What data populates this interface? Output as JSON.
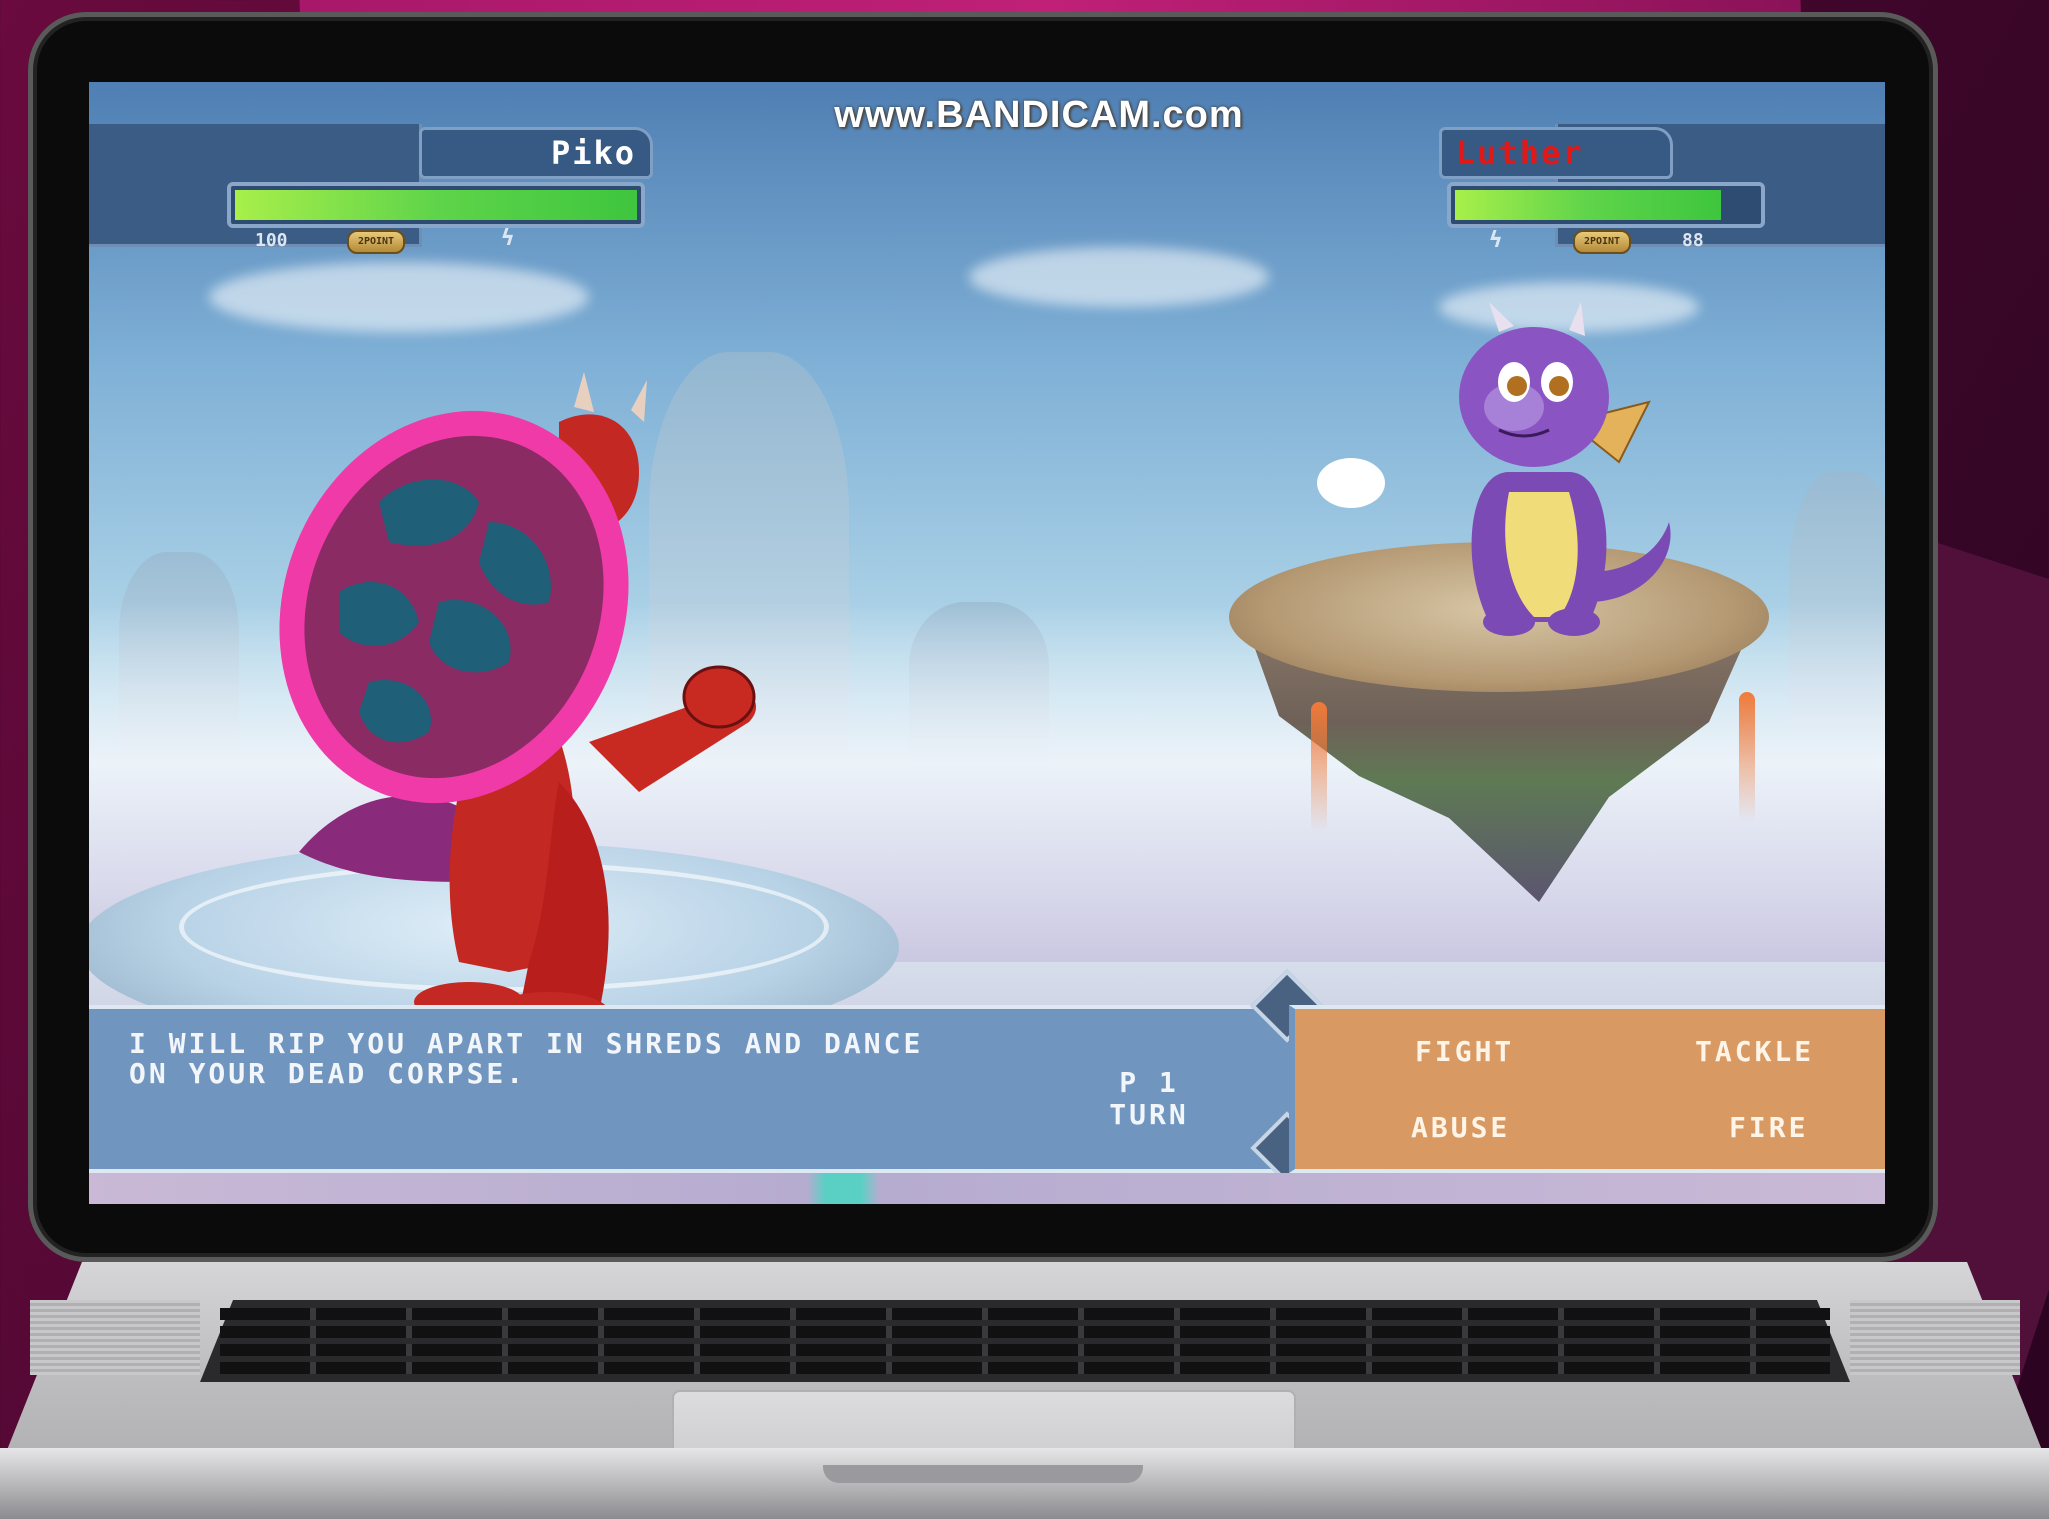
{
  "watermark": "www.BANDICAM.com",
  "player1": {
    "name": "Piko",
    "name_color": "#ffffff",
    "hp_value": "100",
    "hp_fraction": 1.0,
    "badge": "2POINT",
    "icon": "lightning-icon"
  },
  "player2": {
    "name": "Luther",
    "name_color": "#e01818",
    "hp_value": "88",
    "hp_fraction": 0.88,
    "badge": "2POINT",
    "icon": "lightning-icon"
  },
  "dialog": {
    "text_line1": "I WILL RIP YOU APART IN SHREDS AND DANCE",
    "text_line2": "ON YOUR DEAD CORPSE.",
    "turn_line1": "P 1",
    "turn_line2": "TURN"
  },
  "menu": {
    "fight": "FIGHT",
    "tackle": "TACKLE",
    "abuse": "ABUSE",
    "fire": "FIRE"
  },
  "colors": {
    "dialog_bg": "#7096bf",
    "menu_bg": "#d89a62",
    "hp_green": "#5fd44a"
  }
}
